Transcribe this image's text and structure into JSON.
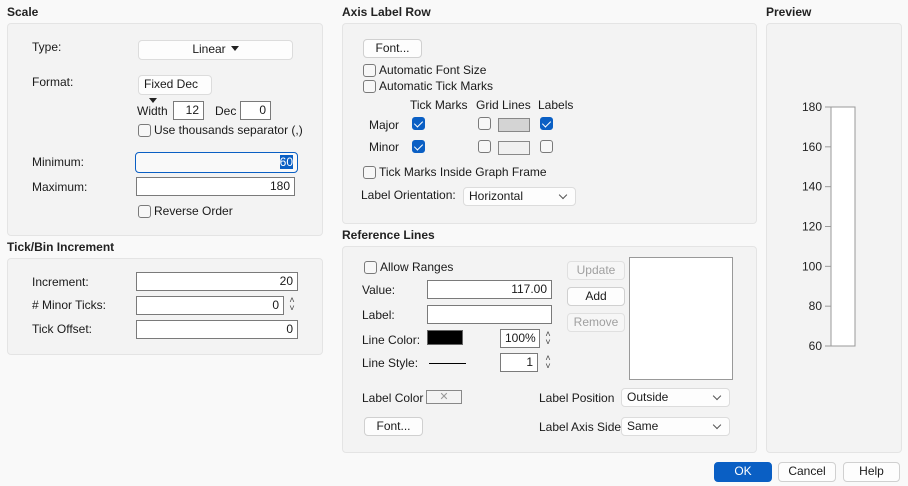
{
  "scale": {
    "title": "Scale",
    "type_label": "Type:",
    "type_value": "Linear",
    "format_label": "Format:",
    "format_value": "Fixed Dec",
    "width_label": "Width",
    "width_value": "12",
    "dec_label": "Dec",
    "dec_value": "0",
    "thousands_label": "Use thousands separator (,)",
    "thousands_checked": false,
    "min_label": "Minimum:",
    "min_value": "60",
    "max_label": "Maximum:",
    "max_value": "180",
    "reverse_label": "Reverse Order",
    "reverse_checked": false
  },
  "tick": {
    "title": "Tick/Bin Increment",
    "increment_label": "Increment:",
    "increment_value": "20",
    "minor_label": "# Minor Ticks:",
    "minor_value": "0",
    "offset_label": "Tick Offset:",
    "offset_value": "0"
  },
  "axis": {
    "title": "Axis Label Row",
    "font_button": "Font...",
    "auto_font_label": "Automatic Font Size",
    "auto_tick_label": "Automatic Tick Marks",
    "col_tick": "Tick Marks",
    "col_grid": "Grid Lines",
    "col_labels": "Labels",
    "major_label": "Major",
    "minor_label": "Minor",
    "inside_label": "Tick Marks Inside Graph Frame",
    "orientation_label": "Label Orientation:",
    "orientation_value": "Horizontal",
    "major_grid_color": "#d4d4d4",
    "minor_grid_color": "#f0f0f0"
  },
  "ref": {
    "title": "Reference Lines",
    "allow_ranges": "Allow Ranges",
    "value_label": "Value:",
    "value": "117.00",
    "label_label": "Label:",
    "label_value": "",
    "line_color_label": "Line Color:",
    "line_color": "#000000",
    "opacity": "100%",
    "line_style_label": "Line Style:",
    "line_width": "1",
    "update_button": "Update",
    "add_button": "Add",
    "remove_button": "Remove",
    "label_color_label": "Label Color",
    "font_button": "Font...",
    "label_position_label": "Label Position",
    "label_position_value": "Outside",
    "label_axis_side_label": "Label Axis Side",
    "label_axis_side_value": "Same"
  },
  "preview": {
    "title": "Preview"
  },
  "footer": {
    "ok": "OK",
    "cancel": "Cancel",
    "help": "Help"
  },
  "chart_data": {
    "type": "axis-preview",
    "ylim": [
      60,
      180
    ],
    "ticks": [
      60,
      80,
      100,
      120,
      140,
      160,
      180
    ],
    "tick_labels": [
      "60",
      "80",
      "100",
      "120",
      "140",
      "160",
      "180"
    ]
  }
}
